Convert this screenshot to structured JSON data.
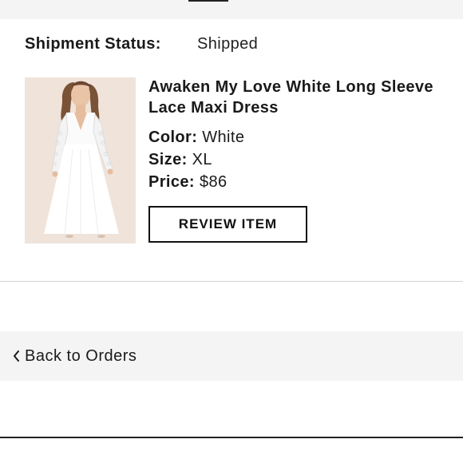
{
  "shipment": {
    "status_label": "Shipment Status:",
    "status_value": "Shipped"
  },
  "product": {
    "title": "Awaken My Love White Long Sleeve Lace Maxi Dress",
    "color_label": "Color:",
    "color_value": "White",
    "size_label": "Size:",
    "size_value": "XL",
    "price_label": "Price:",
    "price_value": "$86",
    "image_icon": "dress-photo"
  },
  "actions": {
    "review_label": "REVIEW ITEM",
    "back_label": "Back to Orders",
    "back_icon": "chevron-left-icon"
  },
  "colors": {
    "accent": "#111111",
    "bar_bg": "#f4f4f4",
    "image_bg": "#efe3da"
  }
}
